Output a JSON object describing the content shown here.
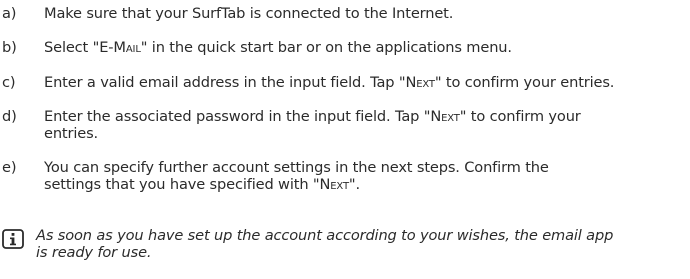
{
  "steps": [
    {
      "letter": "a)",
      "text": "Make sure that your SurfTab is connected to the Internet."
    },
    {
      "letter": "b)",
      "before": "Select \"",
      "cap": "E-M",
      "small": "ail",
      "after": "\" in the quick start bar or on the applications menu."
    },
    {
      "letter": "c)",
      "before": "Enter a valid email address in the input field. Tap \"",
      "cap": "N",
      "small": "ext",
      "after": "\" to confirm your entries."
    },
    {
      "letter": "d)",
      "line1_before": "Enter the associated password in the input field. Tap \"",
      "line1_cap": "N",
      "line1_small": "ext",
      "line1_after": "\" to confirm your",
      "line2": "entries."
    },
    {
      "letter": "e)",
      "line1": "You can specify further account settings in the next steps. Confirm the",
      "line2_before": "settings that you have specified with \"",
      "line2_cap": "N",
      "line2_small": "ext",
      "line2_after": "\"."
    }
  ],
  "note": {
    "icon": "info-icon",
    "line1": "As soon as you have set up the account according to your wishes, the email app",
    "line2": "is ready for use."
  }
}
